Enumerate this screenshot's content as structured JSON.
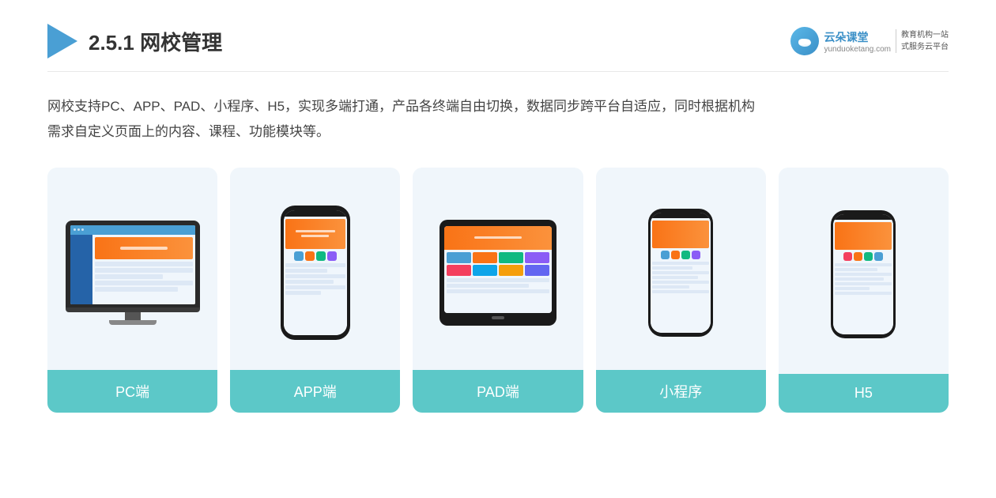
{
  "header": {
    "title_prefix": "2.5.1 ",
    "title_main": "网校管理",
    "brand": {
      "name": "云朵课堂",
      "domain": "yunduoketang.com",
      "slogan_line1": "教育机构一站",
      "slogan_line2": "式服务云平台"
    }
  },
  "description": {
    "text": "网校支持PC、APP、PAD、小程序、H5，实现多端打通，产品各终端自由切换，数据同步跨平台自适应，同时根据机构\n需求自定义页面上的内容、课程、功能模块等。"
  },
  "cards": [
    {
      "id": "pc",
      "label": "PC端"
    },
    {
      "id": "app",
      "label": "APP端"
    },
    {
      "id": "pad",
      "label": "PAD端"
    },
    {
      "id": "miniapp",
      "label": "小程序"
    },
    {
      "id": "h5",
      "label": "H5"
    }
  ],
  "colors": {
    "card_bg": "#f0f6fb",
    "card_label_bg": "#5cc8c8",
    "accent_blue": "#4a9fd4",
    "brand_blue": "#3a8fc7"
  }
}
